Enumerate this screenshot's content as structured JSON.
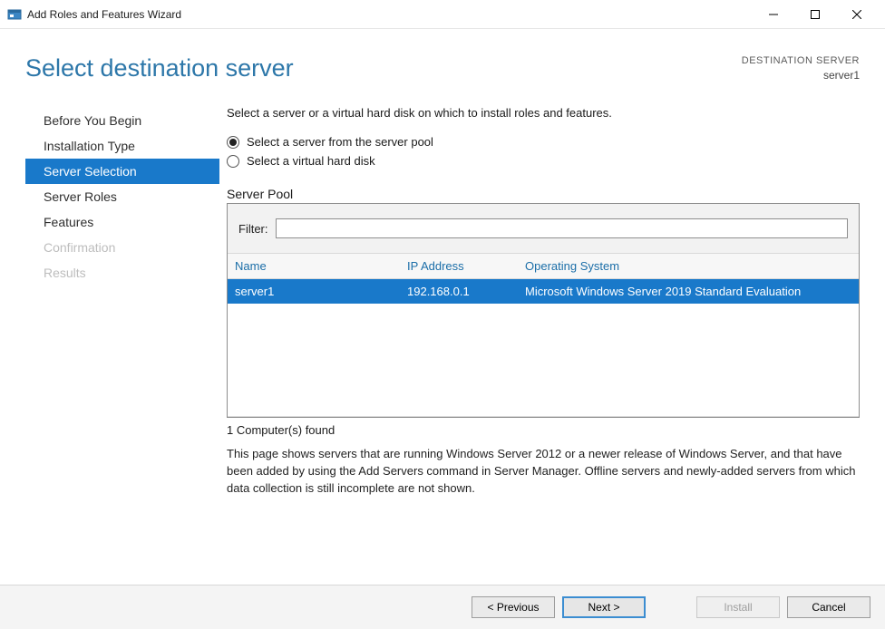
{
  "window": {
    "title": "Add Roles and Features Wizard"
  },
  "header": {
    "page_title": "Select destination server",
    "dest_label": "DESTINATION SERVER",
    "dest_server": "server1"
  },
  "sidebar": {
    "items": [
      {
        "label": "Before You Begin",
        "state": "normal"
      },
      {
        "label": "Installation Type",
        "state": "normal"
      },
      {
        "label": "Server Selection",
        "state": "selected"
      },
      {
        "label": "Server Roles",
        "state": "normal"
      },
      {
        "label": "Features",
        "state": "normal"
      },
      {
        "label": "Confirmation",
        "state": "disabled"
      },
      {
        "label": "Results",
        "state": "disabled"
      }
    ]
  },
  "main": {
    "instruction": "Select a server or a virtual hard disk on which to install roles and features.",
    "radios": [
      {
        "label": "Select a server from the server pool",
        "checked": true
      },
      {
        "label": "Select a virtual hard disk",
        "checked": false
      }
    ],
    "pool_label": "Server Pool",
    "filter_label": "Filter:",
    "filter_value": "",
    "columns": {
      "name": "Name",
      "ip": "IP Address",
      "os": "Operating System"
    },
    "rows": [
      {
        "name": "server1",
        "ip": "192.168.0.1",
        "os": "Microsoft Windows Server 2019 Standard Evaluation",
        "selected": true
      }
    ],
    "found_text": "1 Computer(s) found",
    "help_text": "This page shows servers that are running Windows Server 2012 or a newer release of Windows Server, and that have been added by using the Add Servers command in Server Manager. Offline servers and newly-added servers from which data collection is still incomplete are not shown."
  },
  "footer": {
    "previous": "< Previous",
    "next": "Next >",
    "install": "Install",
    "cancel": "Cancel"
  }
}
